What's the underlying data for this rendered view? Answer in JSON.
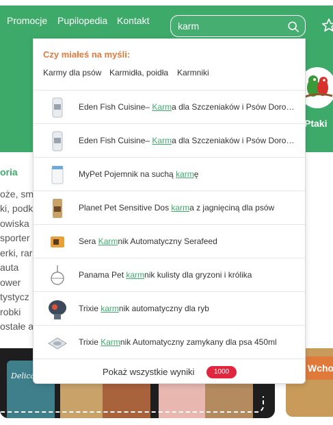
{
  "nav": {
    "links": [
      "Promocje",
      "Pupilopedia",
      "Kontakt"
    ]
  },
  "search": {
    "value": "karm"
  },
  "hero": {
    "category_label": "Ptaki"
  },
  "sidebar": {
    "title": "oria",
    "items": [
      "oże, sm",
      "ki, podk",
      "owiska",
      "sporter",
      "erki, rar",
      "auta",
      "ower",
      "tystycz",
      "robki",
      "ostałe a"
    ]
  },
  "promo": {
    "can_label": "Delicatesse",
    "cta_partial": "Wcho"
  },
  "dropdown": {
    "heading": "Czy miałeś na myśli:",
    "suggestions": [
      "Karmy dla psów",
      "Karmidła, poidła",
      "Karmniki"
    ],
    "results": [
      {
        "pre": "Eden Fish Cuisine– ",
        "hl": "Karm",
        "post": "a dla Szczeniaków i Psów Dorosłych"
      },
      {
        "pre": "Eden Fish Cuisine– ",
        "hl": "Karm",
        "post": "a dla Szczeniaków i Psów Dorosłych"
      },
      {
        "pre": "MyPet Pojemnik na suchą ",
        "hl": "karm",
        "post": "ę"
      },
      {
        "pre": "Planet Pet Sensitive Dos ",
        "hl": "karm",
        "post": "a z jagnięciną dla psów"
      },
      {
        "pre": "Sera ",
        "hl": "Karm",
        "post": "nik Automatyczny Serafeed"
      },
      {
        "pre": "Panama Pet ",
        "hl": "karm",
        "post": "nik kulisty dla gryzoni i królika"
      },
      {
        "pre": "Trixie ",
        "hl": "karm",
        "post": "nik automatyczny dla ryb"
      },
      {
        "pre": "Trixie ",
        "hl": "Karm",
        "post": "nik Automatyczny zamykany dla psa 450ml"
      }
    ],
    "show_all": "Pokaż wszystkie wyniki",
    "count": "1000"
  },
  "colors": {
    "brand_green": "#3daa6a",
    "accent_orange": "#e07a3b",
    "badge_red": "#e0253f"
  }
}
